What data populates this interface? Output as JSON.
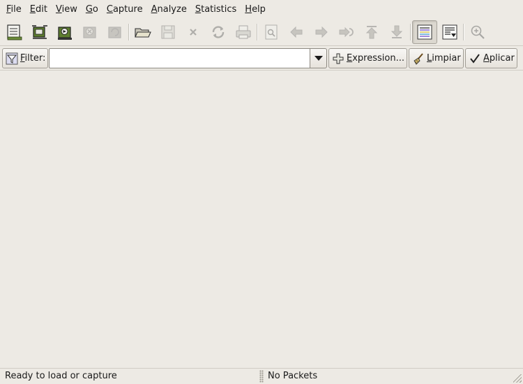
{
  "menu": [
    {
      "mnemonic": "F",
      "rest": "ile"
    },
    {
      "mnemonic": "E",
      "rest": "dit"
    },
    {
      "mnemonic": "V",
      "rest": "iew"
    },
    {
      "mnemonic": "G",
      "rest": "o"
    },
    {
      "mnemonic": "C",
      "rest": "apture"
    },
    {
      "mnemonic": "A",
      "rest": "nalyze"
    },
    {
      "mnemonic": "S",
      "rest": "tatistics"
    },
    {
      "mnemonic": "H",
      "rest": "elp"
    }
  ],
  "toolbar": {
    "icons": [
      "interface-list-icon",
      "capture-options-icon",
      "start-capture-icon",
      "stop-capture-icon",
      "restart-capture-icon",
      "open-icon",
      "save-icon",
      "close-icon",
      "reload-icon",
      "print-icon",
      "find-packet-icon",
      "go-back-icon",
      "go-forward-icon",
      "go-to-packet-icon",
      "first-packet-icon",
      "last-packet-icon",
      "colorize-icon",
      "autoscroll-icon",
      "zoom-in-icon"
    ]
  },
  "filter": {
    "label_mnemonic": "F",
    "label_rest": "ilter:",
    "value": "",
    "expression_label_mnemonic": "E",
    "expression_label_rest": "xpression...",
    "clear_label_mnemonic": "L",
    "clear_label_rest": "impiar",
    "apply_label_mnemonic": "A",
    "apply_label_rest": "plicar"
  },
  "status": {
    "left": "Ready to load or capture",
    "right": "No Packets"
  },
  "colors": {
    "background": "#edeae4",
    "border": "#a19d95"
  }
}
